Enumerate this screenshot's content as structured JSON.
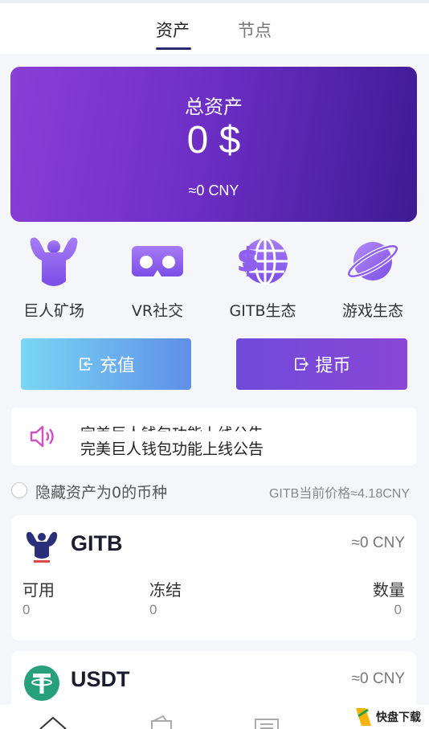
{
  "tabs": [
    {
      "label": "资产",
      "active": true
    },
    {
      "label": "节点",
      "active": false
    }
  ],
  "asset": {
    "title": "总资产",
    "value": "0 $",
    "cny": "≈0 CNY"
  },
  "features": [
    {
      "label": "巨人矿场",
      "icon": "muscle-icon"
    },
    {
      "label": "VR社交",
      "icon": "vr-goggles-icon"
    },
    {
      "label": "GITB生态",
      "icon": "coin-globe-icon"
    },
    {
      "label": "游戏生态",
      "icon": "planet-icon"
    }
  ],
  "actions": {
    "recharge": "充值",
    "withdraw": "提币"
  },
  "notice": {
    "previous": "完美巨人钱包功能上线公告",
    "current": "完美巨人钱包功能上线公告"
  },
  "filter": {
    "hide_zero_label": "隐藏资产为0的币种",
    "price_text": "GITB当前价格≈4.18CNY"
  },
  "coins": [
    {
      "name": "GITB",
      "cny": "≈0 CNY",
      "columns": [
        {
          "label": "可用",
          "value": "0"
        },
        {
          "label": "冻结",
          "value": "0"
        },
        {
          "label": "数量",
          "value": "0"
        }
      ]
    },
    {
      "name": "USDT",
      "cny": "≈0 CNY"
    }
  ],
  "watermark": {
    "text": "快盘下载"
  },
  "colors": {
    "card_start": "#8a3fd6",
    "card_end": "#3d1b93",
    "feature_purple": "#9b6cf0",
    "usdt_green": "#26a17b"
  }
}
